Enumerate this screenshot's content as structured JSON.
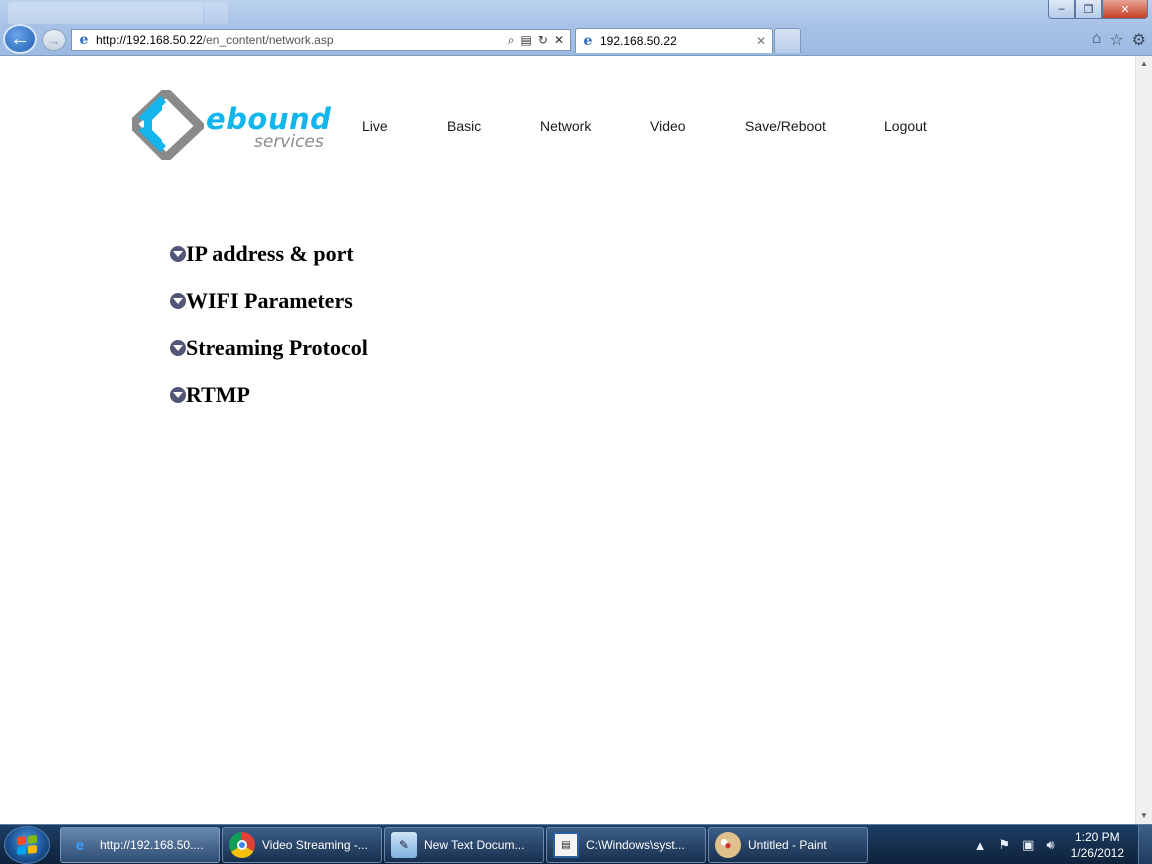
{
  "browser": {
    "address_url_host": "http://192.168.50.22",
    "address_url_path": "/en_content/network.asp",
    "tab_title": "192.168.50.22"
  },
  "page": {
    "logo": {
      "main": "ebound",
      "sub": "services"
    },
    "nav": [
      {
        "label": "Live"
      },
      {
        "label": "Basic"
      },
      {
        "label": "Network"
      },
      {
        "label": "Video"
      },
      {
        "label": "Save/Reboot"
      },
      {
        "label": "Logout"
      }
    ],
    "sections": [
      {
        "label": "IP address & port"
      },
      {
        "label": "WIFI Parameters"
      },
      {
        "label": "Streaming Protocol"
      },
      {
        "label": "RTMP"
      }
    ]
  },
  "taskbar": {
    "items": [
      {
        "label": "http://192.168.50....",
        "icon": "internet-explorer-icon"
      },
      {
        "label": "Video Streaming -...",
        "icon": "chrome-icon"
      },
      {
        "label": "New Text Docum...",
        "icon": "notepad-icon"
      },
      {
        "label": "C:\\Windows\\syst...",
        "icon": "console-icon"
      },
      {
        "label": "Untitled - Paint",
        "icon": "paint-icon"
      }
    ],
    "clock_time": "1:20 PM",
    "clock_date": "1/26/2012"
  },
  "colors": {
    "logo_blue": "#13b6ec",
    "logo_gray": "#8a8a8a",
    "section_arrow": "#52577a"
  }
}
